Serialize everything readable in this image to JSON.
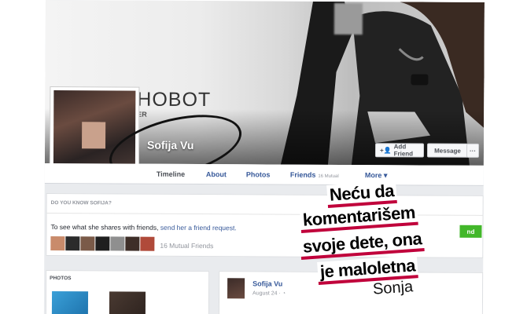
{
  "cover": {
    "brand": "HOBOT",
    "brand_sub": "ER"
  },
  "profile": {
    "name": "Sofija Vu"
  },
  "cover_buttons": {
    "add_friend": "Add Friend",
    "message": "Message",
    "more": "···"
  },
  "tabs": {
    "timeline": "Timeline",
    "about": "About",
    "photos": "Photos",
    "friends": "Friends",
    "friends_count": "16 Mutual",
    "more": "More ▾"
  },
  "know": {
    "title": "DO YOU KNOW SOFIJA?",
    "text": "To see what she shares with friends,",
    "link": "send her a friend request.",
    "mutual": "16 Mutual Friends",
    "add_button": "nd"
  },
  "photos": {
    "title": "PHOTOS"
  },
  "post": {
    "name": "Sofija Vu",
    "date": "August 24 · ◔"
  },
  "quote": {
    "lines": [
      "Neću da",
      "komentarišem",
      "svoje dete, ona",
      "je maloletna"
    ],
    "author": "Sonja"
  },
  "colors": {
    "fb_link": "#365899",
    "quote_underline": "#c0003b",
    "add_green": "#42b72a"
  }
}
